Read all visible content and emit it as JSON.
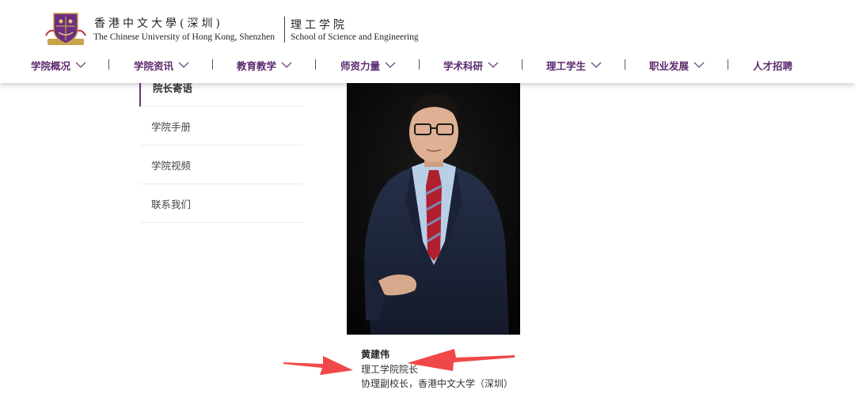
{
  "header": {
    "university_cn": "香港中文大學(深圳)",
    "university_en": "The Chinese University of Hong Kong, Shenzhen",
    "school_cn": "理工学院",
    "school_en": "School of Science and Engineering"
  },
  "nav": {
    "items": [
      {
        "label": "学院概况",
        "dropdown": true
      },
      {
        "label": "学院资讯",
        "dropdown": true
      },
      {
        "label": "教育教学",
        "dropdown": true
      },
      {
        "label": "师资力量",
        "dropdown": true
      },
      {
        "label": "学术科研",
        "dropdown": true
      },
      {
        "label": "理工学生",
        "dropdown": true
      },
      {
        "label": "职业发展",
        "dropdown": true
      },
      {
        "label": "人才招聘",
        "dropdown": false
      }
    ]
  },
  "sidebar": {
    "items": [
      {
        "label": "院长寄语",
        "active": true
      },
      {
        "label": "学院手册",
        "active": false
      },
      {
        "label": "学院视频",
        "active": false
      },
      {
        "label": "联系我们",
        "active": false
      }
    ]
  },
  "profile": {
    "name": "黄建伟",
    "title": "理工学院院长",
    "role": "协理副校长，香港中文大学（深圳）"
  },
  "colors": {
    "brand_purple": "#5b2a6e",
    "annotation_red": "#f04848"
  },
  "icons": {
    "crest": "university-crest-icon",
    "dropdown": "chevron-down-icon",
    "annotation": "red-arrow-icon"
  }
}
